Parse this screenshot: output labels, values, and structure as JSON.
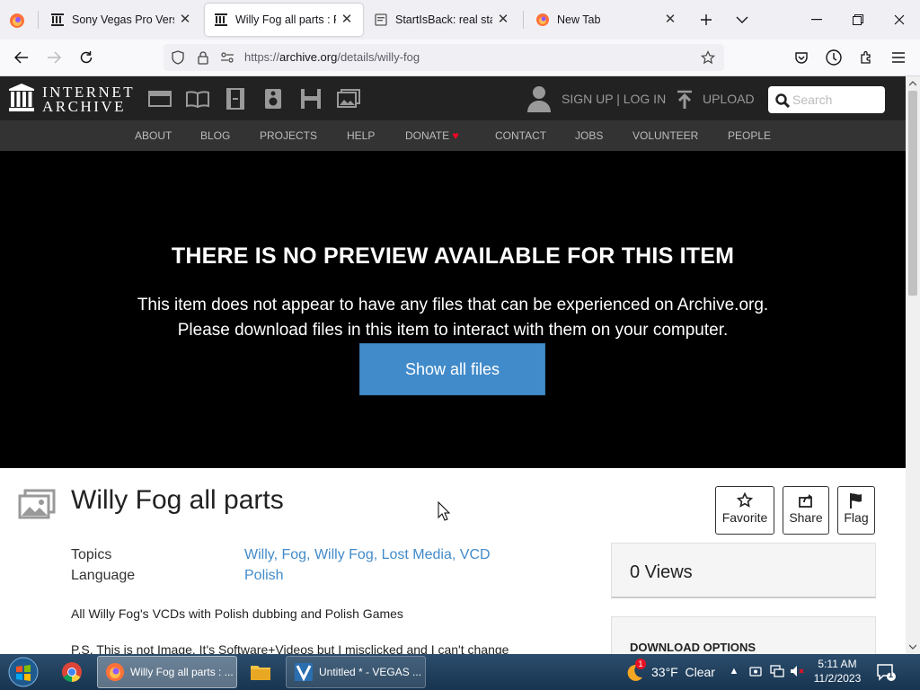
{
  "browser": {
    "tabs": [
      {
        "title": "Sony Vegas Pro Version",
        "icon": "archive-icon",
        "active": false
      },
      {
        "title": "Willy Fog all parts : Free",
        "icon": "archive-icon",
        "active": true
      },
      {
        "title": "StartIsBack: real start m",
        "icon": "page-icon",
        "active": false
      },
      {
        "title": "New Tab",
        "icon": "firefox-icon",
        "active": false
      }
    ],
    "url_prefix": "https://",
    "url_host": "archive.org",
    "url_path": "/details/willy-fog"
  },
  "ia": {
    "logo_line1": "INTERNET",
    "logo_line2": "ARCHIVE",
    "media_icons": [
      "web-icon",
      "texts-icon",
      "video-icon",
      "audio-icon",
      "software-icon",
      "images-icon"
    ],
    "signup_label": "SIGN UP | LOG IN",
    "upload_label": "UPLOAD",
    "search_placeholder": "Search",
    "nav": [
      "ABOUT",
      "BLOG",
      "PROJECTS",
      "HELP",
      "DONATE",
      "CONTACT",
      "JOBS",
      "VOLUNTEER",
      "PEOPLE"
    ]
  },
  "preview": {
    "title": "THERE IS NO PREVIEW AVAILABLE FOR THIS ITEM",
    "line1": "This item does not appear to have any files that can be experienced on Archive.org.",
    "line2": "Please download files in this item to interact with them on your computer.",
    "button": "Show all files"
  },
  "item": {
    "title": "Willy Fog all parts",
    "actions": {
      "favorite": "Favorite",
      "share": "Share",
      "flag": "Flag"
    },
    "topics_label": "Topics",
    "topics": [
      "Willy",
      "Fog",
      "Willy Fog",
      "Lost Media",
      "VCD"
    ],
    "language_label": "Language",
    "language": "Polish",
    "description": "All Willy Fog's VCDs with Polish dubbing and Polish Games",
    "description2": "P.S. This is not Image. It's Software+Videos but I misclicked and I can't change",
    "views": "0 Views",
    "download_options": "DOWNLOAD OPTIONS"
  },
  "taskbar": {
    "tasks": [
      {
        "label": "Willy Fog all parts : ...",
        "active": true
      },
      {
        "label": "Untitled * - VEGAS ...",
        "active": false
      }
    ],
    "weather": "33°F  Clear",
    "weather_badge": "1",
    "time": "5:11 AM",
    "date": "11/2/2023",
    "notif_count": "1"
  },
  "colors": {
    "ia_dark": "#222222",
    "ia_sub": "#333333",
    "link": "#428bca",
    "button": "#428bca"
  }
}
